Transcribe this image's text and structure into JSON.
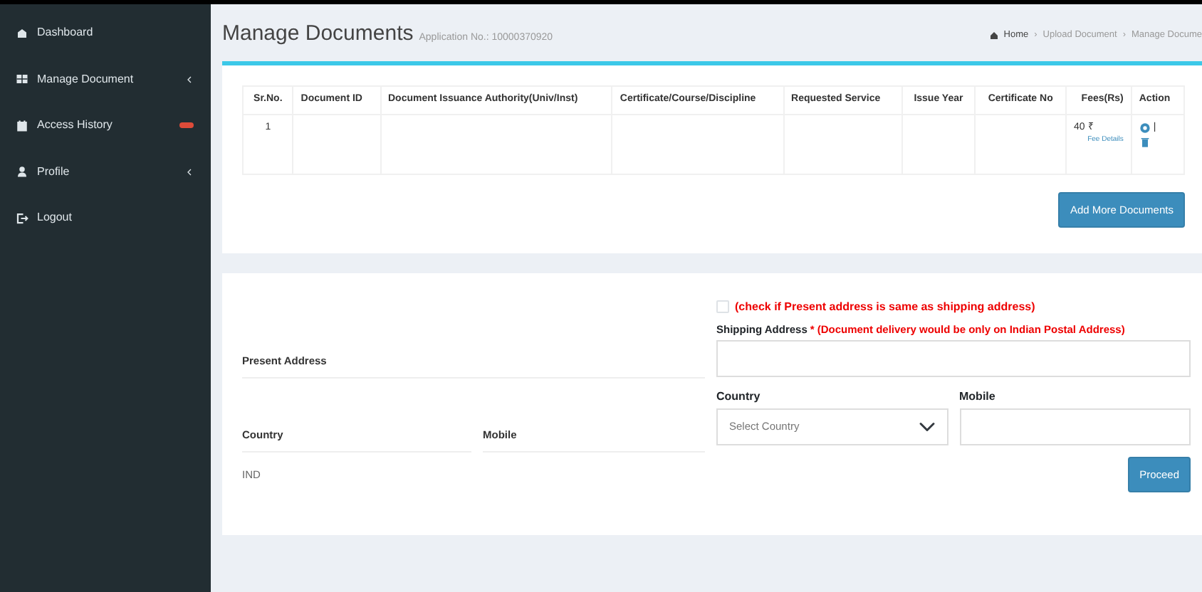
{
  "sidebar": {
    "items": [
      {
        "label": "Dashboard",
        "submenu": false
      },
      {
        "label": "Manage Document",
        "submenu": true
      },
      {
        "label": "Access History",
        "submenu": false,
        "badge": {
          "color": "#dd4b39"
        }
      },
      {
        "label": "Profile",
        "submenu": true
      },
      {
        "label": "Logout",
        "submenu": false
      }
    ]
  },
  "header": {
    "title": "Manage Documents",
    "subtitle": "Application No.: 10000370920",
    "breadcrumb": [
      "Home",
      "Upload Document",
      "Manage Docume"
    ],
    "breadcrumb_separators": [
      "›",
      "›"
    ]
  },
  "table": {
    "columns": [
      "Sr.No.",
      "Document ID",
      "Document Issuance Authority(Univ/Inst)",
      "Certificate/Course/Discipline",
      "Requested Service",
      "Issue Year",
      "Certificate No",
      "Fees(Rs)",
      "Action"
    ],
    "rows": [
      {
        "sr": "1",
        "fee": "40 ₹",
        "fee_link": "Fee Details",
        "action_separator": "|"
      }
    ]
  },
  "add_button": "Add More Documents",
  "address": {
    "checkbox": {
      "checked": false,
      "label": "(check if Present address is same as shipping address)"
    },
    "present_label": "Present Address",
    "shipping_label": "Shipping Address",
    "required_mark": "*",
    "shipping_note": "(Document delivery would be only on Indian Postal Address)",
    "present_country_label": "Country",
    "present_country": "IND",
    "present_mobile_label": "Mobile",
    "country_label": "Country",
    "country_placeholder": "Select Country",
    "mobile_label": "Mobile"
  },
  "proceed_button": "Proceed"
}
